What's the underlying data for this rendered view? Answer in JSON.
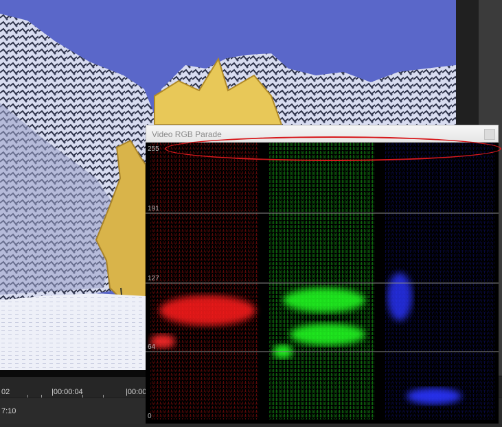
{
  "scope": {
    "title": "Video RGB Parade",
    "levels": [
      "255",
      "191",
      "127",
      "64",
      "0"
    ]
  },
  "timeline": {
    "ticks": [
      "02",
      "|00:00:04",
      "|00:00"
    ],
    "current_timecode": "7:10"
  },
  "colors": {
    "annotation": "#d7191c",
    "red_channel": "#ff2020",
    "green_channel": "#20ff20",
    "blue_channel": "#2030ff",
    "sky": "#5866c6"
  },
  "icons": [
    "close-icon"
  ]
}
